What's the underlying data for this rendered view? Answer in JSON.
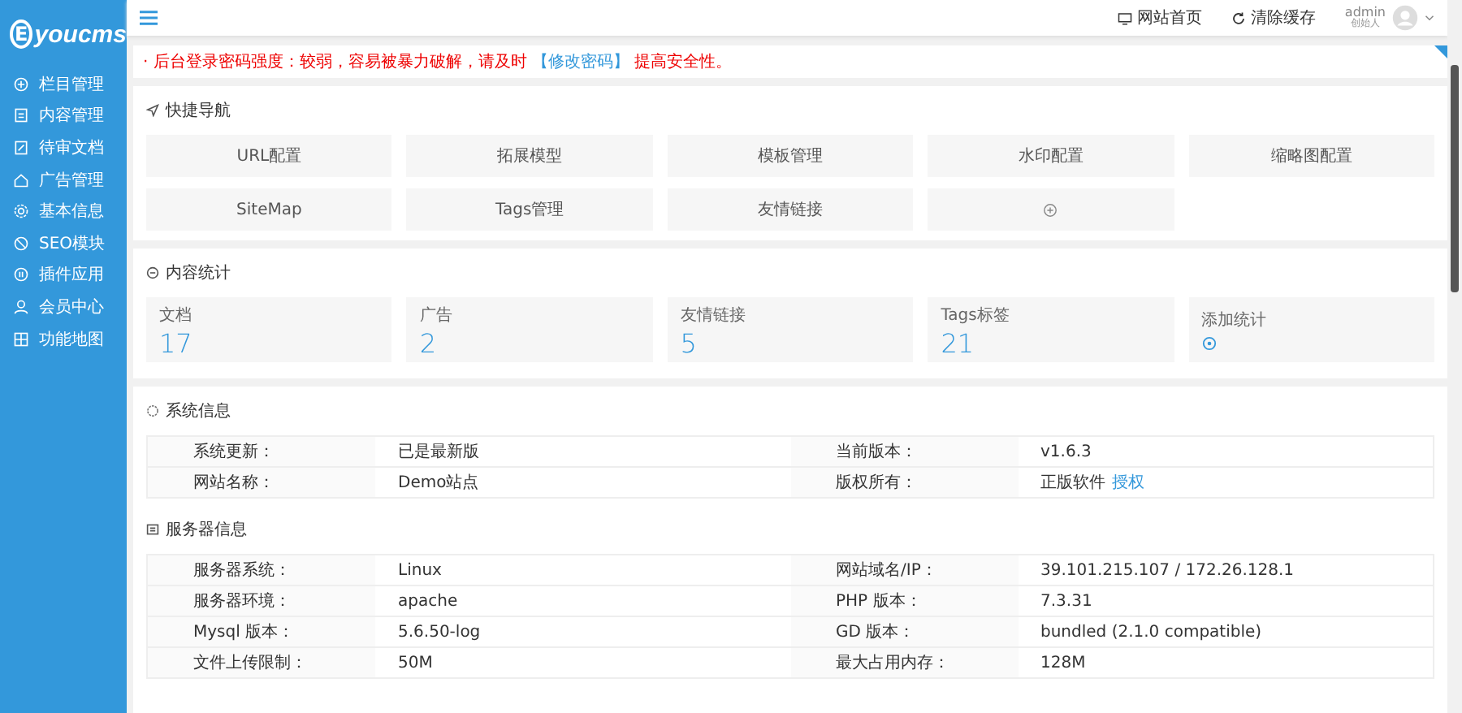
{
  "logo": {
    "text": "youcms",
    "letter": "E"
  },
  "sidebar": {
    "items": [
      {
        "label": "栏目管理"
      },
      {
        "label": "内容管理"
      },
      {
        "label": "待审文档"
      },
      {
        "label": "广告管理"
      },
      {
        "label": "基本信息"
      },
      {
        "label": "SEO模块"
      },
      {
        "label": "插件应用"
      },
      {
        "label": "会员中心"
      },
      {
        "label": "功能地图"
      }
    ]
  },
  "topbar": {
    "links": [
      {
        "label": "网站首页"
      },
      {
        "label": "清除缓存"
      }
    ],
    "user": {
      "name": "admin",
      "role": "创始人"
    }
  },
  "alert": {
    "before": "· 后台登录密码强度：较弱，容易被暴力破解，请及时",
    "link": "【修改密码】",
    "after": "提高安全性。"
  },
  "quick_nav": {
    "title": "快捷导航",
    "items": [
      {
        "kind": "text",
        "label": "URL配置"
      },
      {
        "kind": "text",
        "label": "拓展模型"
      },
      {
        "kind": "text",
        "label": "模板管理"
      },
      {
        "kind": "text",
        "label": "水印配置"
      },
      {
        "kind": "text",
        "label": "缩略图配置"
      },
      {
        "kind": "text",
        "label": "SiteMap"
      },
      {
        "kind": "text",
        "label": "Tags管理"
      },
      {
        "kind": "text",
        "label": "友情链接"
      },
      {
        "kind": "add"
      }
    ]
  },
  "stats": {
    "title": "内容统计",
    "items": [
      {
        "kind": "number",
        "label": "文档",
        "value": "17"
      },
      {
        "kind": "number",
        "label": "广告",
        "value": "2"
      },
      {
        "kind": "number",
        "label": "友情链接",
        "value": "5"
      },
      {
        "kind": "number",
        "label": "Tags标签",
        "value": "21"
      },
      {
        "kind": "add",
        "label": "添加统计"
      }
    ]
  },
  "system_info": {
    "title": "系统信息",
    "rows": [
      [
        {
          "label": "系统更新：",
          "value": "已是最新版"
        },
        {
          "label": "当前版本：",
          "value": "v1.6.3"
        }
      ],
      [
        {
          "label": "网站名称：",
          "value": "Demo站点"
        },
        {
          "label": "版权所有：",
          "value": "正版软件",
          "link": "授权"
        }
      ]
    ]
  },
  "server_info": {
    "title": "服务器信息",
    "rows": [
      [
        {
          "label": "服务器系统：",
          "value": "Linux"
        },
        {
          "label": "网站域名/IP：",
          "value": "39.101.215.107 / 172.26.128.1"
        }
      ],
      [
        {
          "label": "服务器环境：",
          "value": "apache"
        },
        {
          "label": "PHP 版本：",
          "value": "7.3.31"
        }
      ],
      [
        {
          "label": "Mysql 版本：",
          "value": "5.6.50-log"
        },
        {
          "label": "GD 版本：",
          "value": "bundled (2.1.0 compatible)"
        }
      ],
      [
        {
          "label": "文件上传限制：",
          "value": "50M"
        },
        {
          "label": "最大占用内存：",
          "value": "128M"
        }
      ]
    ]
  }
}
